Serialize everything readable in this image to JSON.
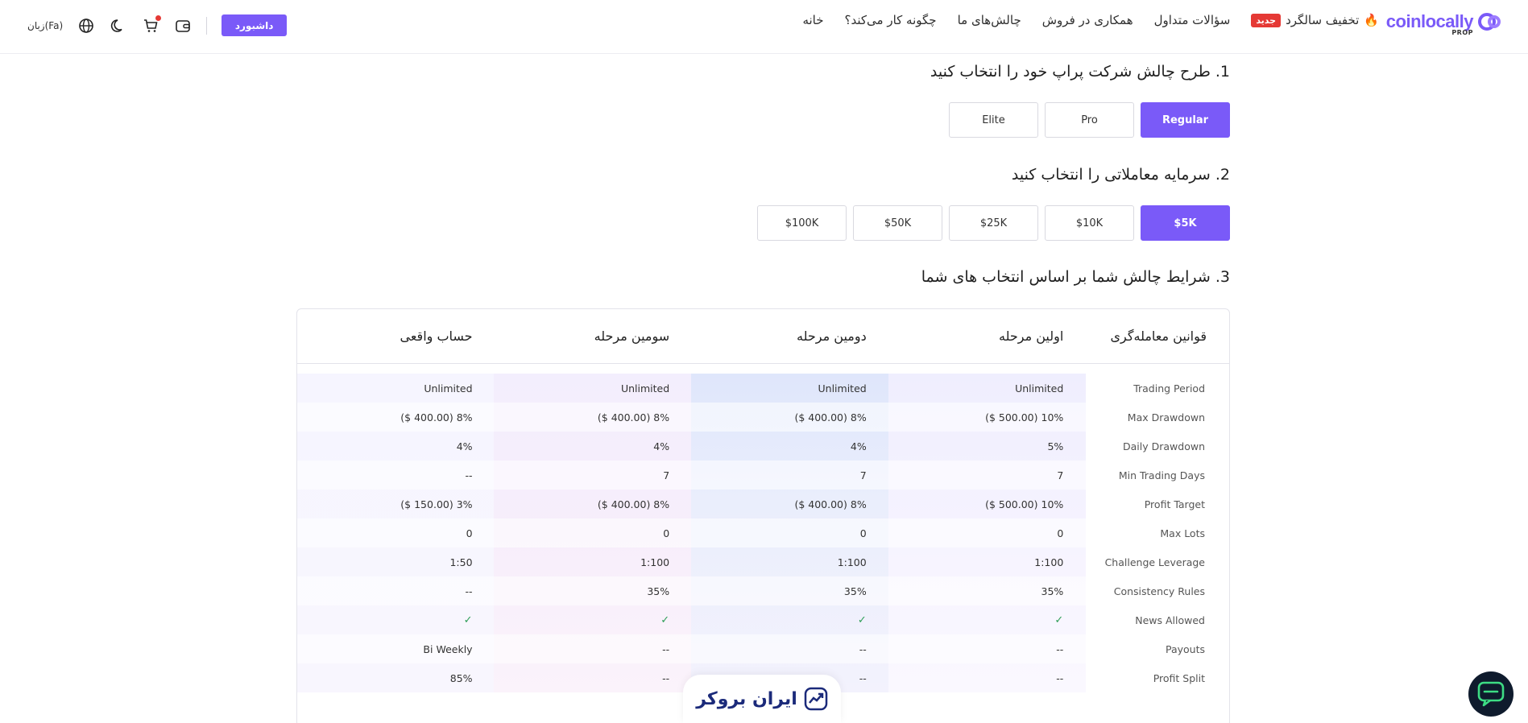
{
  "header": {
    "logo_text": "coinlocally",
    "logo_sub": "PROP",
    "nav": [
      "خانه",
      "چگونه کار می‌کند؟",
      "چالش‌های ما",
      "همکاری در فروش",
      "سؤالات متداول"
    ],
    "discount_label": "تخفیف سالگرد",
    "new_badge": "جدید",
    "dashboard_label": "داشبورد",
    "language_label": "زبان(Fa)"
  },
  "section1": {
    "title": "1. طرح چالش شرکت پراپ خود را انتخاب کنید",
    "options": [
      "Regular",
      "Pro",
      "Elite"
    ],
    "selected": "Regular"
  },
  "section2": {
    "title": "2. سرمایه معاملاتی را انتخاب کنید",
    "options": [
      "$5K",
      "$10K",
      "$25K",
      "$50K",
      "$100K"
    ],
    "selected": "$5K"
  },
  "section3": {
    "title": "3. شرایط چالش شما بر اساس انتخاب های شما"
  },
  "table": {
    "headers": [
      "قوانین معامله‌گری",
      "اولین مرحله",
      "دومین مرحله",
      "سومین مرحله",
      "حساب واقعی"
    ],
    "rows": [
      [
        "Trading Period",
        "Unlimited",
        "Unlimited",
        "Unlimited",
        "Unlimited"
      ],
      [
        "Max Drawdown",
        "10% (500.00 $)",
        "8% (400.00 $)",
        "8% (400.00 $)",
        "8% (400.00 $)"
      ],
      [
        "Daily Drawdown",
        "5%",
        "4%",
        "4%",
        "4%"
      ],
      [
        "Min Trading Days",
        "7",
        "7",
        "7",
        "--"
      ],
      [
        "Profit Target",
        "10% (500.00 $)",
        "8% (400.00 $)",
        "8% (400.00 $)",
        "3% (150.00 $)"
      ],
      [
        "Max Lots",
        "0",
        "0",
        "0",
        "0"
      ],
      [
        "Challenge Leverage",
        "1:100",
        "1:100",
        "1:100",
        "1:50"
      ],
      [
        "Consistency Rules",
        "35%",
        "35%",
        "35%",
        "--"
      ],
      [
        "News Allowed",
        "✓",
        "✓",
        "✓",
        "✓"
      ],
      [
        "Payouts",
        "--",
        "--",
        "--",
        "Bi Weekly"
      ],
      [
        "Profit Split",
        "--",
        "--",
        "--",
        "85%"
      ]
    ]
  },
  "watermark": {
    "text": "ایران بروکر"
  },
  "colors": {
    "accent": "#7a5af8",
    "check": "#2e9e57",
    "badge": "#e53935"
  }
}
